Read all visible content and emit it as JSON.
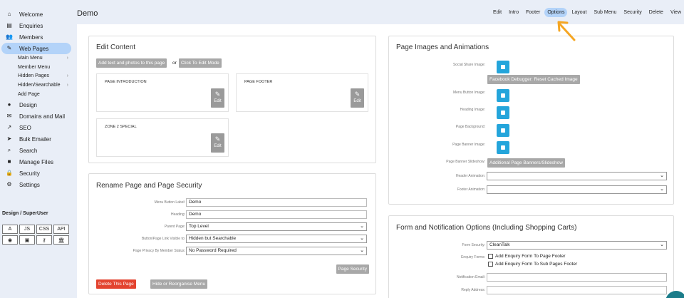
{
  "sidebar": {
    "items": [
      {
        "label": "Welcome",
        "icon": "home-icon",
        "glyph": "⌂"
      },
      {
        "label": "Enquiries",
        "icon": "message-icon",
        "glyph": "▤"
      },
      {
        "label": "Members",
        "icon": "users-icon",
        "glyph": "👥"
      },
      {
        "label": "Web Pages",
        "icon": "pencil-icon",
        "glyph": "✎",
        "active": true
      },
      {
        "label": "Design",
        "icon": "palette-icon",
        "glyph": "●"
      },
      {
        "label": "Domains and Mail",
        "icon": "mail-icon",
        "glyph": "✉"
      },
      {
        "label": "SEO",
        "icon": "trending-icon",
        "glyph": "↗"
      },
      {
        "label": "Bulk Emailer",
        "icon": "send-icon",
        "glyph": "➤"
      },
      {
        "label": "Search",
        "icon": "search-icon",
        "glyph": "⌕"
      },
      {
        "label": "Manage Files",
        "icon": "folder-icon",
        "glyph": "■"
      },
      {
        "label": "Security",
        "icon": "lock-icon",
        "glyph": "🔒"
      },
      {
        "label": "Settings",
        "icon": "gear-icon",
        "glyph": "⚙"
      }
    ],
    "subitems": [
      {
        "label": "Main Menu",
        "chevron": true
      },
      {
        "label": "Member Menu",
        "chevron": false
      },
      {
        "label": "Hidden Pages",
        "chevron": true
      },
      {
        "label": "Hidden/Searchable",
        "chevron": true
      },
      {
        "label": "Add Page",
        "chevron": false
      }
    ],
    "section_title": "Design / SuperUser",
    "superuser_buttons": [
      "A",
      "JS",
      "CSS",
      "API",
      "◉",
      "▣",
      "⚷",
      "🏛"
    ]
  },
  "header": {
    "title": "Demo",
    "tabs": [
      "Edit",
      "Intro",
      "Footer",
      "Options",
      "Layout",
      "Sub Menu",
      "Security",
      "Delete",
      "View"
    ],
    "active_tab": "Options"
  },
  "edit_content": {
    "title": "Edit Content",
    "add_button": "Add text and photos to this page",
    "or_text": "or",
    "edit_mode_button": "Click To Edit Mode",
    "zones": [
      {
        "label": "PAGE INTRODUCTION",
        "edit": "Edit"
      },
      {
        "label": "PAGE FOOTER",
        "edit": "Edit"
      },
      {
        "label": "ZONE 2 SPECIAL",
        "edit": "Edit"
      }
    ]
  },
  "rename": {
    "title": "Rename Page and Page Security",
    "fields": [
      {
        "label": "Menu Button Label:",
        "value": "Demo",
        "type": "input"
      },
      {
        "label": "Heading:",
        "value": "Demo",
        "type": "input"
      },
      {
        "label": "Parent Page:",
        "value": "Top Level",
        "type": "select"
      },
      {
        "label": "Button/Page Link Visible to:",
        "value": "Hidden but Searchable",
        "type": "select"
      },
      {
        "label": "Page Privacy By Member Status:",
        "value": "No Password Required",
        "type": "select"
      }
    ],
    "page_security_button": "Page Security",
    "delete_button": "Delete This Page",
    "hide_button": "Hide or Reorganise Menu"
  },
  "images": {
    "title": "Page Images and Animations",
    "rows": [
      {
        "label": "Social Share Image:"
      },
      {
        "label": "Menu Button Image:"
      },
      {
        "label": "Heading Image:"
      },
      {
        "label": "Page Background:"
      },
      {
        "label": "Page Banner Image:"
      }
    ],
    "debugger_button": "Facebook Debugger: Reset Cached Image",
    "slideshow_label": "Page Banner Slideshow:",
    "slideshow_button": "Additional Page Banners/Slideshow",
    "header_anim_label": "Header Animation:",
    "footer_anim_label": "Footer Animation:"
  },
  "form_options": {
    "title": "Form and Notification Options (Including Shopping Carts)",
    "form_security_label": "Form Security:",
    "form_security_value": "CleanTalk",
    "enquiry_label": "Enquiry Forms:",
    "checkbox1": "Add Enquiry Form To Page Footer",
    "checkbox2": "Add Enquiry Form To Sub Pages Footer",
    "notification_label": "Notification Email:",
    "reply_label": "Reply Address:"
  },
  "colors": {
    "accent": "#24a5db",
    "active_bg": "#b3d3f9",
    "danger": "#e3432f",
    "arrow": "#f5a623"
  }
}
